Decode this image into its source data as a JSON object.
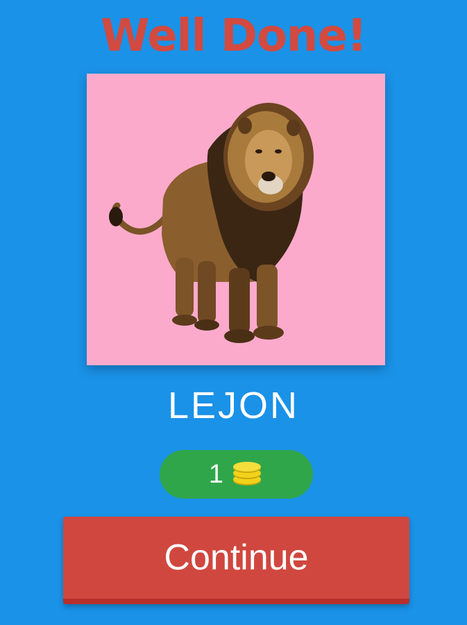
{
  "header": {
    "title": "Well Done!"
  },
  "question": {
    "image_icon": "lion-image",
    "image_background": "#fcaacc",
    "answer": "LEJON"
  },
  "reward": {
    "count": "1",
    "icon": "coin-stack-icon"
  },
  "actions": {
    "continue_label": "Continue"
  },
  "colors": {
    "background": "#1a92e8",
    "title": "#d24a40",
    "reward_pill": "#2fa64a",
    "coin": "#f3d21a",
    "continue_button": "#d0473f"
  }
}
